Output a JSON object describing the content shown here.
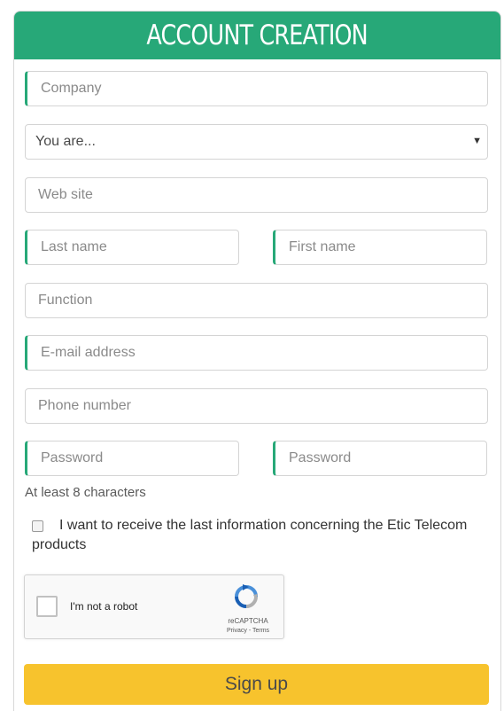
{
  "header": {
    "title": "ACCOUNT CREATION"
  },
  "form": {
    "company": {
      "placeholder": "Company"
    },
    "you_are": {
      "selected": "You are..."
    },
    "website": {
      "placeholder": "Web site"
    },
    "last_name": {
      "placeholder": "Last name"
    },
    "first_name": {
      "placeholder": "First name"
    },
    "function": {
      "placeholder": "Function"
    },
    "email": {
      "placeholder": "E-mail address"
    },
    "phone": {
      "placeholder": "Phone number"
    },
    "password": {
      "placeholder": "Password"
    },
    "password_confirm": {
      "placeholder": "Password"
    },
    "password_hint": "At least 8 characters",
    "newsletter": {
      "label": "I want to receive the last information concerning the Etic Telecom products",
      "checked": false
    }
  },
  "recaptcha": {
    "label": "I'm not a robot",
    "brand": "reCAPTCHA",
    "links": "Privacy - Terms"
  },
  "submit": {
    "label": "Sign up"
  },
  "colors": {
    "header_bg": "#27a878",
    "required_accent": "#27a878",
    "submit_bg": "#f7c32d"
  }
}
